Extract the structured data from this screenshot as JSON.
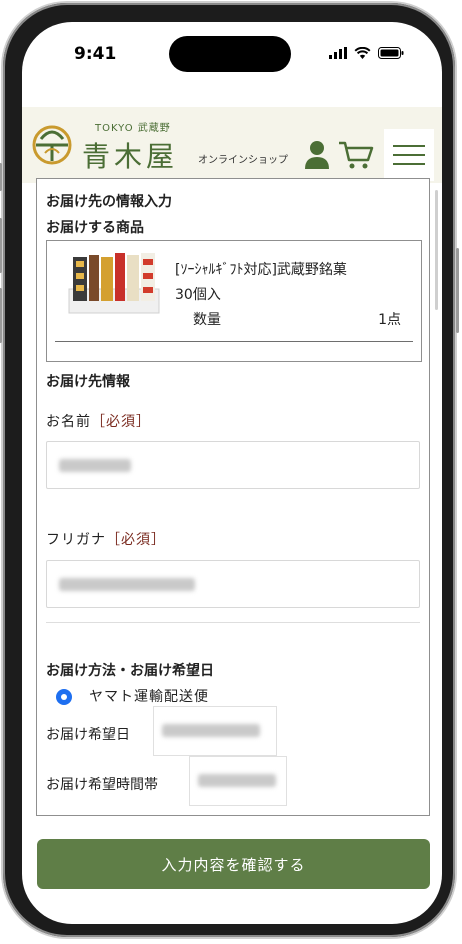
{
  "status_bar": {
    "time": "9:41"
  },
  "header": {
    "brand_small": "TOKYO 武蔵野",
    "brand_main": "青木屋",
    "shop_label": "オンラインショップ",
    "accent_color": "#4b6e35",
    "icons": [
      "logo-icon",
      "user-icon",
      "cart-icon",
      "menu-icon"
    ]
  },
  "form": {
    "title": "お届け先の情報入力",
    "product_section_title": "お届けする商品",
    "product": {
      "name_line1": "[ｿｰｼｬﾙｷﾞﾌﾄ対応]武蔵野銘菓",
      "name_line2": "30個入",
      "qty_label": "数量",
      "qty_value": "1点"
    },
    "recipient_section_title": "お届け先情報",
    "name_label": "お名前",
    "name_required": "［必須］",
    "kana_label": "フリガナ",
    "kana_required": "［必須］",
    "delivery_section_title": "お届け方法・お届け希望日",
    "delivery_method": "ヤマト運輸配送便",
    "delivery_date_label": "お届け希望日",
    "delivery_time_label": "お届け希望時間帯"
  },
  "submit_label": "入力内容を確認する",
  "colors": {
    "button": "#5f7e47",
    "required": "#7a2a1f",
    "radio": "#1e6ff0"
  }
}
